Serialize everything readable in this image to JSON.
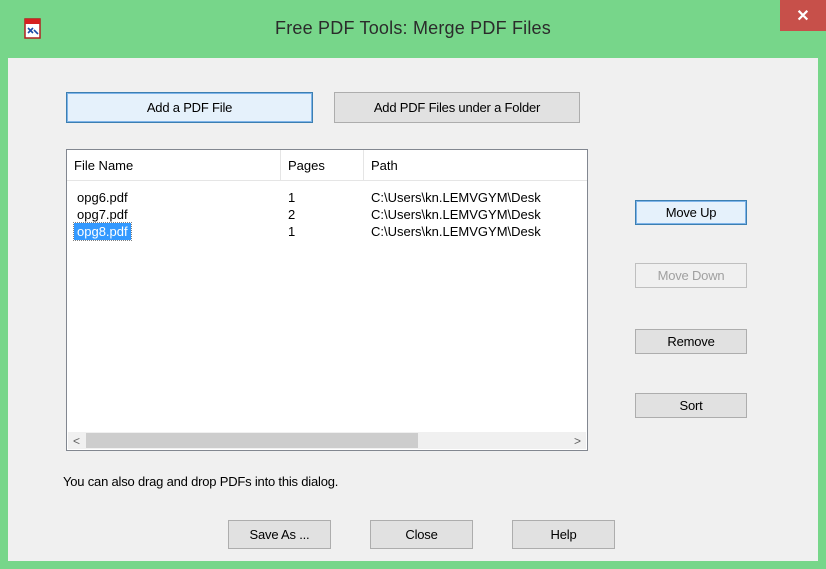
{
  "window": {
    "title": "Free PDF Tools: Merge PDF Files",
    "app_icon": "pdf-tool-icon",
    "close_glyph": "✕",
    "titlebar_color": "#77d68a",
    "close_color": "#c7504a"
  },
  "buttons": {
    "add_pdf_file": "Add a PDF File",
    "add_pdf_folder": "Add PDF Files under a Folder",
    "move_up": "Move Up",
    "move_down": "Move Down",
    "remove": "Remove",
    "sort": "Sort",
    "save_as": "Save As ...",
    "close": "Close",
    "help": "Help"
  },
  "list": {
    "columns": [
      "File Name",
      "Pages",
      "Path"
    ],
    "rows": [
      {
        "file": "opg6.pdf",
        "pages": "1",
        "path": "C:\\Users\\kn.LEMVGYM\\Desk"
      },
      {
        "file": "opg7.pdf",
        "pages": "2",
        "path": "C:\\Users\\kn.LEMVGYM\\Desk"
      },
      {
        "file": "opg8.pdf",
        "pages": "1",
        "path": "C:\\Users\\kn.LEMVGYM\\Desk"
      }
    ],
    "selected_index": 2,
    "scroll_left_glyph": "<",
    "scroll_right_glyph": ">"
  },
  "hint_text": "You can also drag and drop PDFs into this dialog."
}
